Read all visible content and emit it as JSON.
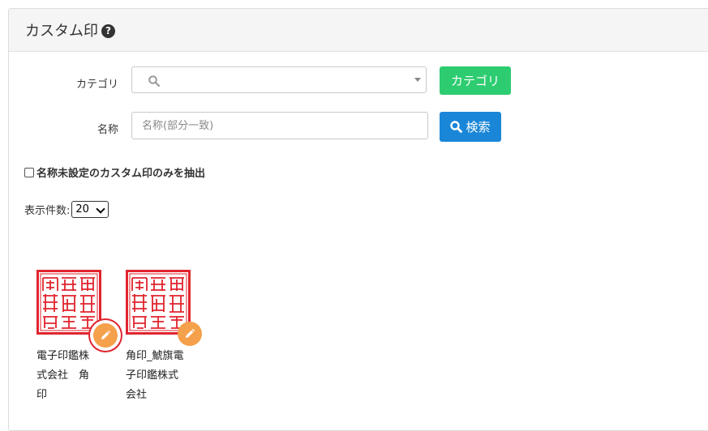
{
  "panel": {
    "title": "カスタム印"
  },
  "icons": {
    "help": "question-circle-icon",
    "search": "search-icon",
    "edit": "pencil-icon"
  },
  "filters": {
    "category_label": "カテゴリ",
    "category_value": "",
    "category_button": "カテゴリ",
    "name_label": "名称",
    "name_placeholder": "名称(部分一致)",
    "name_value": "",
    "search_button": "検索",
    "checkbox_label": "名称未設定のカスタム印のみを抽出",
    "checkbox_checked": false
  },
  "pagination": {
    "label": "表示件数:",
    "per_page": "20"
  },
  "stamps": [
    {
      "caption": "電子印鑑株\n式会社　角\n印",
      "stamp_text": "鯱旗電子印鑑株式会社之印",
      "selected": true
    },
    {
      "caption": "角印_鯱旗電\n子印鑑株式\n会社",
      "stamp_text": "鯱旗電子印鑑株式会社之印",
      "selected": false
    }
  ],
  "colors": {
    "stamp_red": "#e0242e",
    "green_button": "#2ecc71",
    "blue_button": "#1a86d8",
    "edit_orange": "#f5a04a"
  }
}
